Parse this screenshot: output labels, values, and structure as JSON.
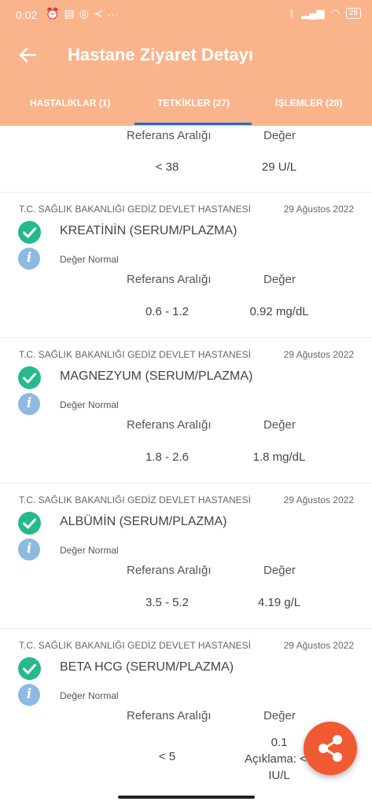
{
  "status_bar": {
    "time": "0:02",
    "battery": "28",
    "more": "···"
  },
  "header": {
    "title": "Hastane Ziyaret Detayı"
  },
  "tabs": [
    {
      "label": "HASTALIKLAR (1)"
    },
    {
      "label": "TETKİKLER (27)",
      "active": true
    },
    {
      "label": "İŞLEMLER (28)"
    }
  ],
  "labels": {
    "reference_range": "Referans Aralığı",
    "value": "Değer"
  },
  "top_partial": {
    "reference": "< 38",
    "value": "29 U/L"
  },
  "cards": [
    {
      "hospital": "T.C. SAĞLIK BAKANLIĞI GEDİZ DEVLET HASTANESİ",
      "date": "29 Ağustos 2022",
      "test": "KREATİNİN (SERUM/PLAZMA)",
      "status": "Değer Normal",
      "reference": "0.6 - 1.2",
      "value": "0.92 mg/dL"
    },
    {
      "hospital": "T.C. SAĞLIK BAKANLIĞI GEDİZ DEVLET HASTANESİ",
      "date": "29 Ağustos 2022",
      "test": "MAGNEZYUM (SERUM/PLAZMA)",
      "status": "Değer Normal",
      "reference": "1.8 - 2.6",
      "value": "1.8 mg/dL"
    },
    {
      "hospital": "T.C. SAĞLIK BAKANLIĞI GEDİZ DEVLET HASTANESİ",
      "date": "29 Ağustos 2022",
      "test": "ALBÜMİN (SERUM/PLAZMA)",
      "status": "Değer Normal",
      "reference": "3.5 - 5.2",
      "value": "4.19 g/L"
    },
    {
      "hospital": "T.C. SAĞLIK BAKANLIĞI GEDİZ DEVLET HASTANESİ",
      "date": "29 Ağustos 2022",
      "test": "BETA HCG (SERUM/PLAZMA)",
      "status": "Değer Normal",
      "reference": "< 5",
      "value_lines": [
        "0.1",
        "Açıklama: <T",
        "IU/L"
      ]
    }
  ],
  "colors": {
    "header": "#f9b48c",
    "tab_indicator": "#1f6fd1",
    "check": "#27b98e",
    "info": "#8eb9e0",
    "fab": "#f05a33"
  },
  "icons": {
    "back": "arrow-left-icon",
    "check": "check-circle-icon",
    "info": "info-icon",
    "share": "share-icon"
  }
}
